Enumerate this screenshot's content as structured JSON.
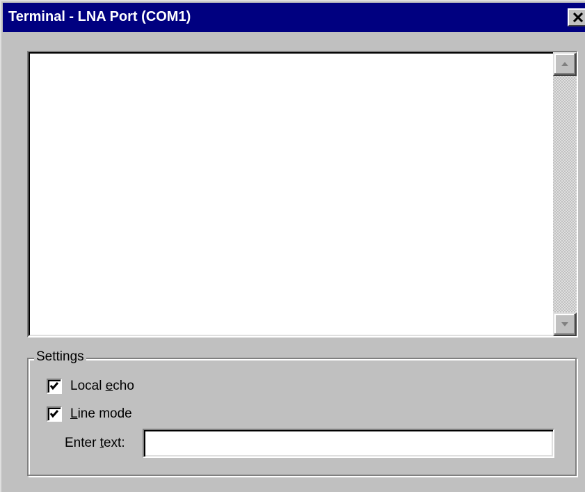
{
  "window": {
    "title": "Terminal - LNA Port (COM1)",
    "close_icon": "close-icon",
    "titlebar_color": "#000080",
    "face_color": "#c0c0c0"
  },
  "output": {
    "text": "",
    "scroll_up_icon": "arrow-up-icon",
    "scroll_down_icon": "arrow-down-icon"
  },
  "settings": {
    "group_label": "Settings",
    "local_echo": {
      "label_pre": "Local ",
      "label_mnemonic": "e",
      "label_post": "cho",
      "checked": true
    },
    "line_mode": {
      "label_pre": "",
      "label_mnemonic": "L",
      "label_post": "ine mode",
      "checked": true
    },
    "enter_text": {
      "label_pre": "Enter ",
      "label_mnemonic": "t",
      "label_post": "ext:",
      "value": "",
      "placeholder": ""
    }
  }
}
